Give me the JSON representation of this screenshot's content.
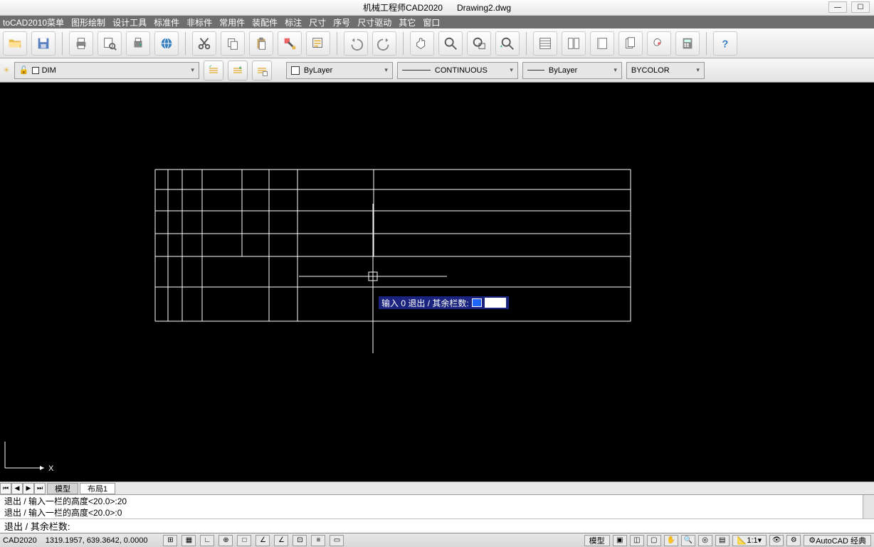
{
  "title": {
    "app": "机械工程师CAD2020",
    "doc": "Drawing2.dwg"
  },
  "menu": [
    "toCAD2010菜单",
    "图形绘制",
    "设计工具",
    "标准件",
    "非标件",
    "常用件",
    "装配件",
    "标注",
    "尺寸",
    "序号",
    "尺寸驱动",
    "其它",
    "窗口"
  ],
  "layer": {
    "name": "DIM"
  },
  "props": {
    "color": "ByLayer",
    "ltype": "CONTINUOUS",
    "lweight": "ByLayer",
    "cstyle": "BYCOLOR"
  },
  "tabs": {
    "model": "模型",
    "layout1": "布局1"
  },
  "cmd_history": [
    "退出 / 输入一栏的高度<20.0>:20",
    "退出 / 输入一栏的高度<20.0>:0"
  ],
  "cmd_current": "退出 / 其余栏数:",
  "tooltip_prompt": "输入 0 退出 / 其余栏数:",
  "status": {
    "app": "CAD2020",
    "coords": "1319.1957, 639.3642, 0.0000",
    "model_btn": "模型",
    "scale": "1:1",
    "workspace": "AutoCAD 经典"
  }
}
